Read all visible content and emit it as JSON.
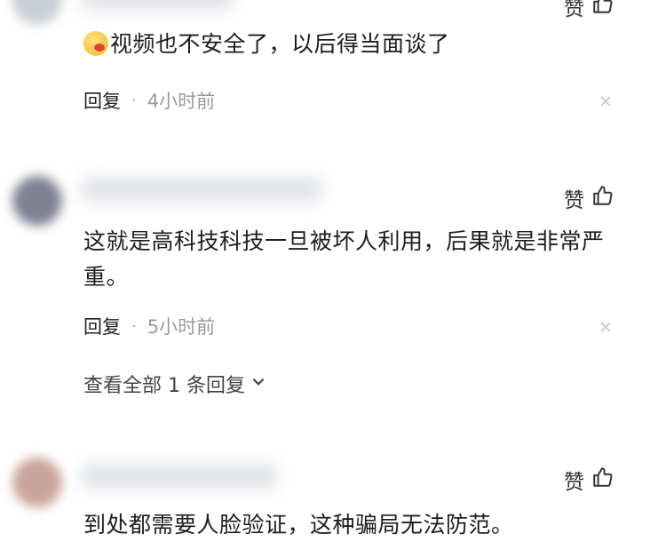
{
  "comments": [
    {
      "like_label": "赞",
      "text": "视频也不安全了，以后得当面谈了",
      "reply_label": "回复",
      "time": "4小时前",
      "avatar_color": "#c9cfd8"
    },
    {
      "like_label": "赞",
      "text": "这就是高科技科技一旦被坏人利用，后果就是非常严重。",
      "reply_label": "回复",
      "time": "5小时前",
      "avatar_color": "#7f8193",
      "more_replies": "查看全部 1 条回复"
    },
    {
      "like_label": "赞",
      "text": "到处都需要人脸验证，这种骗局无法防范。",
      "avatar_color": "#c9a49a"
    }
  ],
  "icons": {
    "like": "thumbs-up-icon",
    "close": "close-icon",
    "expand": "chevron-down-icon",
    "emoji": "emoji-icon"
  }
}
